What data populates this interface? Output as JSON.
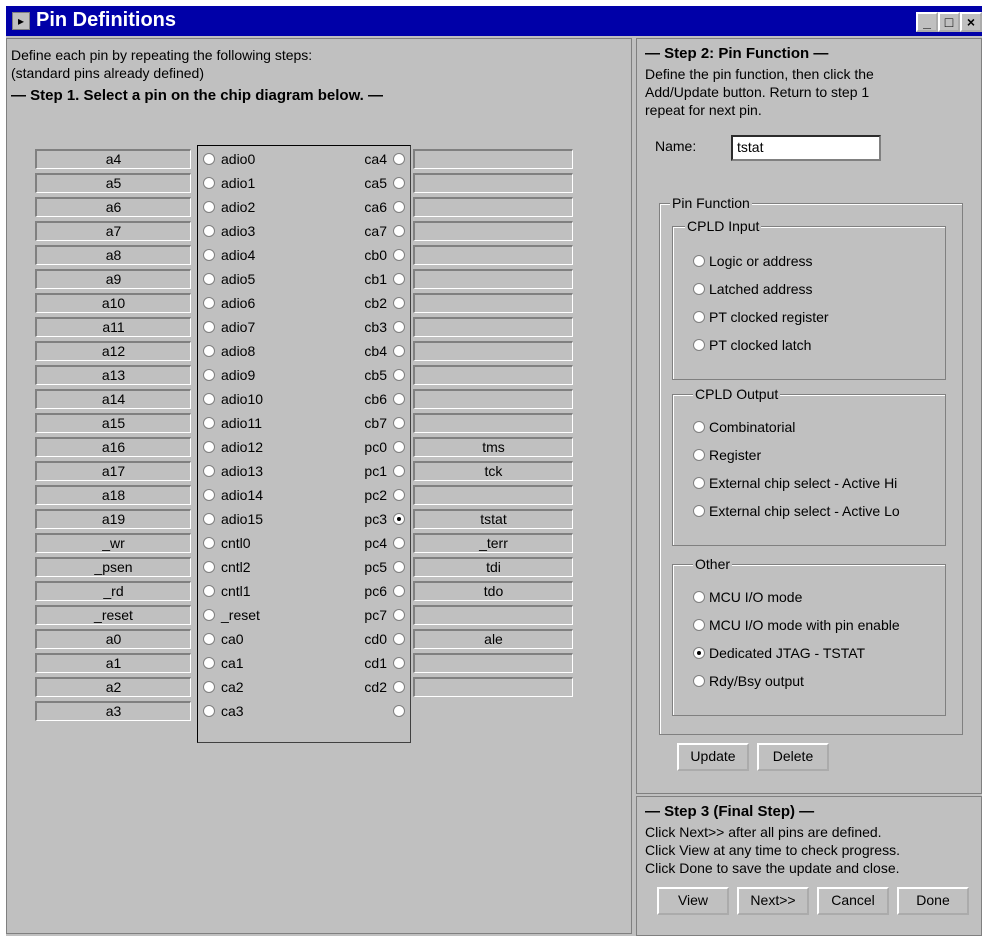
{
  "window": {
    "title": "Pin Definitions"
  },
  "left": {
    "instructions": [
      "Define each pin by repeating the following steps:",
      "(standard pins already defined)"
    ],
    "step1": "— Step 1. Select a pin on the chip diagram below. —",
    "pins_left": [
      {
        "name": "a4",
        "pin": "adio0",
        "selected": false
      },
      {
        "name": "a5",
        "pin": "adio1",
        "selected": false
      },
      {
        "name": "a6",
        "pin": "adio2",
        "selected": false
      },
      {
        "name": "a7",
        "pin": "adio3",
        "selected": false
      },
      {
        "name": "a8",
        "pin": "adio4",
        "selected": false
      },
      {
        "name": "a9",
        "pin": "adio5",
        "selected": false
      },
      {
        "name": "a10",
        "pin": "adio6",
        "selected": false
      },
      {
        "name": "a11",
        "pin": "adio7",
        "selected": false
      },
      {
        "name": "a12",
        "pin": "adio8",
        "selected": false
      },
      {
        "name": "a13",
        "pin": "adio9",
        "selected": false
      },
      {
        "name": "a14",
        "pin": "adio10",
        "selected": false
      },
      {
        "name": "a15",
        "pin": "adio11",
        "selected": false
      },
      {
        "name": "a16",
        "pin": "adio12",
        "selected": false
      },
      {
        "name": "a17",
        "pin": "adio13",
        "selected": false
      },
      {
        "name": "a18",
        "pin": "adio14",
        "selected": false
      },
      {
        "name": "a19",
        "pin": "adio15",
        "selected": false
      },
      {
        "name": "_wr",
        "pin": "cntl0",
        "selected": false
      },
      {
        "name": "_psen",
        "pin": "cntl2",
        "selected": false
      },
      {
        "name": "_rd",
        "pin": "cntl1",
        "selected": false
      },
      {
        "name": "_reset",
        "pin": "_reset",
        "selected": false
      },
      {
        "name": "a0",
        "pin": "ca0",
        "selected": false
      },
      {
        "name": "a1",
        "pin": "ca1",
        "selected": false
      },
      {
        "name": "a2",
        "pin": "ca2",
        "selected": false
      },
      {
        "name": "a3",
        "pin": "ca3",
        "selected": false
      }
    ],
    "pins_right": [
      {
        "pin": "ca4",
        "name": "",
        "selected": false
      },
      {
        "pin": "ca5",
        "name": "",
        "selected": false
      },
      {
        "pin": "ca6",
        "name": "",
        "selected": false
      },
      {
        "pin": "ca7",
        "name": "",
        "selected": false
      },
      {
        "pin": "cb0",
        "name": "",
        "selected": false
      },
      {
        "pin": "cb1",
        "name": "",
        "selected": false
      },
      {
        "pin": "cb2",
        "name": "",
        "selected": false
      },
      {
        "pin": "cb3",
        "name": "",
        "selected": false
      },
      {
        "pin": "cb4",
        "name": "",
        "selected": false
      },
      {
        "pin": "cb5",
        "name": "",
        "selected": false
      },
      {
        "pin": "cb6",
        "name": "",
        "selected": false
      },
      {
        "pin": "cb7",
        "name": "",
        "selected": false
      },
      {
        "pin": "pc0",
        "name": "tms",
        "selected": false
      },
      {
        "pin": "pc1",
        "name": "tck",
        "selected": false
      },
      {
        "pin": "pc2",
        "name": "",
        "selected": false
      },
      {
        "pin": "pc3",
        "name": "tstat",
        "selected": true
      },
      {
        "pin": "pc4",
        "name": "_terr",
        "selected": false
      },
      {
        "pin": "pc5",
        "name": "tdi",
        "selected": false
      },
      {
        "pin": "pc6",
        "name": "tdo",
        "selected": false
      },
      {
        "pin": "pc7",
        "name": "",
        "selected": false
      },
      {
        "pin": "cd0",
        "name": "ale",
        "selected": false
      },
      {
        "pin": "cd1",
        "name": "",
        "selected": false
      },
      {
        "pin": "cd2",
        "name": "",
        "selected": false
      },
      {
        "pin": "",
        "name": "",
        "selected": false
      }
    ]
  },
  "step2": {
    "header": "— Step 2: Pin Function —",
    "desc": [
      "Define the pin function, then click the",
      "Add/Update button. Return to step 1",
      "repeat for next pin."
    ],
    "name_label": "Name:",
    "name_value": "tstat",
    "pin_function_label": "Pin Function",
    "cpld_input": {
      "label": "CPLD Input",
      "options": [
        "Logic or address",
        "Latched address",
        "PT clocked register",
        "PT clocked latch"
      ],
      "selected": -1
    },
    "cpld_output": {
      "label": "CPLD Output",
      "options": [
        "Combinatorial",
        "Register",
        "External chip select - Active Hi",
        "External chip select - Active Lo"
      ],
      "selected": -1
    },
    "other": {
      "label": "Other",
      "options": [
        "MCU I/O mode",
        "MCU I/O mode with pin enable",
        "Dedicated JTAG - TSTAT",
        "Rdy/Bsy output"
      ],
      "selected": 2
    },
    "update_button": "Update",
    "delete_button": "Delete"
  },
  "step3": {
    "header": "— Step 3 (Final Step) —",
    "desc": [
      "Click Next>> after all pins are defined.",
      "Click View at any time to check progress.",
      "Click Done to save the update and close."
    ],
    "buttons": [
      "View",
      "Next>>",
      "Cancel",
      "Done"
    ]
  }
}
